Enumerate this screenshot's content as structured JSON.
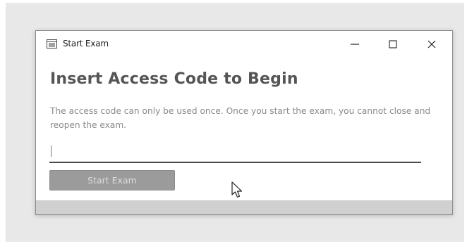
{
  "window": {
    "title": "Start Exam",
    "icon": "list-window-icon",
    "controls": {
      "minimize_icon": "minimize-icon",
      "maximize_icon": "maximize-icon",
      "close_icon": "close-icon"
    }
  },
  "content": {
    "heading": "Insert Access Code to Begin",
    "description": "The access code can only be used once. Once you start the exam, you cannot close and reopen the exam.",
    "access_code": {
      "value": "",
      "placeholder": ""
    },
    "start_button": {
      "label": "Start Exam",
      "state": "disabled"
    }
  },
  "colors": {
    "heading": "#555555",
    "description": "#8a8a8a",
    "button_bg": "#9b9b9b",
    "button_text": "#dcdcdc",
    "footer": "#d0d0d0"
  }
}
